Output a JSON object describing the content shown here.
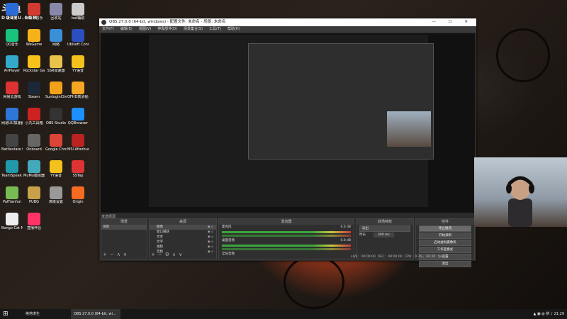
{
  "brand": {
    "logo_text": "斗鱼",
    "logo_sub": "DOUYU.COM"
  },
  "desktop_icons": [
    {
      "label": "此电脑",
      "color": "#2b6bd6"
    },
    {
      "label": "网易云音乐",
      "color": "#d33a31"
    },
    {
      "label": "回收站",
      "color": "#88a"
    },
    {
      "label": "bat辅助",
      "color": "#ccc"
    },
    {
      "label": "QQ音乐",
      "color": "#19c37d"
    },
    {
      "label": "WeGame",
      "color": "#f5b31b"
    },
    {
      "label": "网络",
      "color": "#3a8fd6"
    },
    {
      "label": "Ubisoft Connect",
      "color": "#2a4fbf"
    },
    {
      "label": "AirPlayer",
      "color": "#3ac"
    },
    {
      "label": "Rockstar Games",
      "color": "#f8c21b"
    },
    {
      "label": "SSR加速器",
      "color": "#e8c24b"
    },
    {
      "label": "YY语音",
      "color": "#f5c11c"
    },
    {
      "label": "网易云游戏",
      "color": "#d33"
    },
    {
      "label": "Steam",
      "color": "#1b2838"
    },
    {
      "label": "SunloginClient",
      "color": "#f2a21a"
    },
    {
      "label": "OFHD高清视频",
      "color": "#f5a623"
    },
    {
      "label": "网易UU加速器",
      "color": "#2f77d6"
    },
    {
      "label": "小丸工具箱",
      "color": "#c22"
    },
    {
      "label": "OBS Studio",
      "color": "#333"
    },
    {
      "label": "QQBrowser",
      "color": "#1e90ff"
    },
    {
      "label": "Battlestate Games",
      "color": "#444"
    },
    {
      "label": "Onboard",
      "color": "#666"
    },
    {
      "label": "Google Chrome",
      "color": "#db4437"
    },
    {
      "label": "MSI Afterburner",
      "color": "#b22"
    },
    {
      "label": "TeamSpeak 3",
      "color": "#29a"
    },
    {
      "label": "MuMu模拟器",
      "color": "#4ab"
    },
    {
      "label": "YY语音",
      "color": "#f5c11c"
    },
    {
      "label": "SSTap",
      "color": "#d33"
    },
    {
      "label": "PalTranfun",
      "color": "#7b5"
    },
    {
      "label": "PUBG",
      "color": "#c9a14a"
    },
    {
      "label": "高级设置",
      "color": "#999"
    },
    {
      "label": "Origin",
      "color": "#f56b22"
    },
    {
      "label": "Bongo Cat Mver.exe",
      "color": "#eee"
    },
    {
      "label": "直播伴侣",
      "color": "#f36"
    }
  ],
  "obs": {
    "title": "OBS 27.0.0 (64-bit, windows) - 配置文件: 未命名 - 场景: 未命名",
    "window_controls": "—  ☐  ✕",
    "menu": [
      "文件(F)",
      "编辑(E)",
      "视图(V)",
      "停靠部件(D)",
      "场景集合(S)",
      "工具(T)",
      "帮助(H)"
    ],
    "no_source": "未选择源",
    "panels": {
      "scenes": {
        "title": "场景",
        "items": [
          "场景"
        ]
      },
      "sources": {
        "title": "来源",
        "items": [
          "图像",
          "窗口捕获",
          "文本",
          "文字",
          "视频",
          "音频"
        ]
      },
      "mixer": {
        "title": "混音器",
        "tracks": [
          {
            "name": "麦克风",
            "level": "0.0 dB"
          },
          {
            "name": "桌面音频",
            "level": "0.0 dB"
          }
        ],
        "extra": "全局音频"
      },
      "transitions": {
        "title": "转场特效",
        "type": "淡出",
        "duration_label": "时长",
        "duration": "300 ms"
      },
      "controls": {
        "title": "控件",
        "buttons": [
          "停止推流",
          "开始录制",
          "启动虚拟摄像机",
          "工作室模式",
          "设置",
          "退出"
        ]
      }
    },
    "status": "LIVE: 00:00:00   REC: 00:00:00   CPU: 0.3%, 60.00 fps"
  },
  "taskbar": {
    "start": "⊞",
    "items": [
      "绝地求生",
      "OBS 27.0.0 (64-bit, wi..."
    ],
    "time": "21:29"
  }
}
